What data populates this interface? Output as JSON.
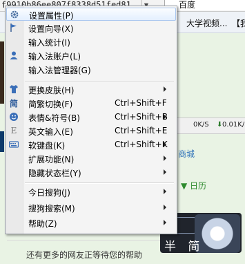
{
  "background": {
    "url_fragment": "f9910b86ee807f8338d51fed81",
    "search_text": "百度",
    "bookmarks": [
      "大学视频...",
      "【我"
    ],
    "status": {
      "up": "0K/S",
      "down": "0.01K/S"
    },
    "link_text": "商城",
    "calendar_label": "日历",
    "ime_mode": "半 简",
    "bottom_text": "还有更多的网友正等待您的帮助"
  },
  "menu": {
    "items": [
      {
        "label": "设置属性(P)",
        "icon": "gear-icon",
        "highlighted": true
      },
      {
        "label": "设置向导(X)",
        "icon": "flag-icon"
      },
      {
        "label": "输入统计(I)",
        "icon": ""
      },
      {
        "label": "输入法账户(L)",
        "icon": "user-icon"
      },
      {
        "label": "输入法管理器(G)",
        "icon": ""
      },
      {
        "label": "更换皮肤(H)",
        "icon": "shirt-icon",
        "submenu": true
      },
      {
        "label": "简繁切换(F)",
        "icon": "simplified-char-icon",
        "shortcut": "Ctrl+Shift+F"
      },
      {
        "label": "表情&符号(B)",
        "icon": "smiley-icon",
        "shortcut": "Ctrl+Shift+B",
        "submenu": true
      },
      {
        "label": "英文输入(E)",
        "icon": "letter-e-icon",
        "shortcut": "Ctrl+Shift+E"
      },
      {
        "label": "软键盘(K)",
        "icon": "keyboard-icon",
        "shortcut": "Ctrl+Shift+K",
        "submenu": true
      },
      {
        "label": "扩展功能(N)",
        "icon": "",
        "submenu": true
      },
      {
        "label": "隐藏状态栏(Y)",
        "icon": "",
        "submenu": true
      },
      {
        "label": "今日搜狗(J)",
        "icon": "",
        "submenu": true
      },
      {
        "label": "搜狗搜索(M)",
        "icon": "",
        "submenu": true
      },
      {
        "label": "帮助(Z)",
        "icon": "",
        "submenu": true
      }
    ]
  }
}
